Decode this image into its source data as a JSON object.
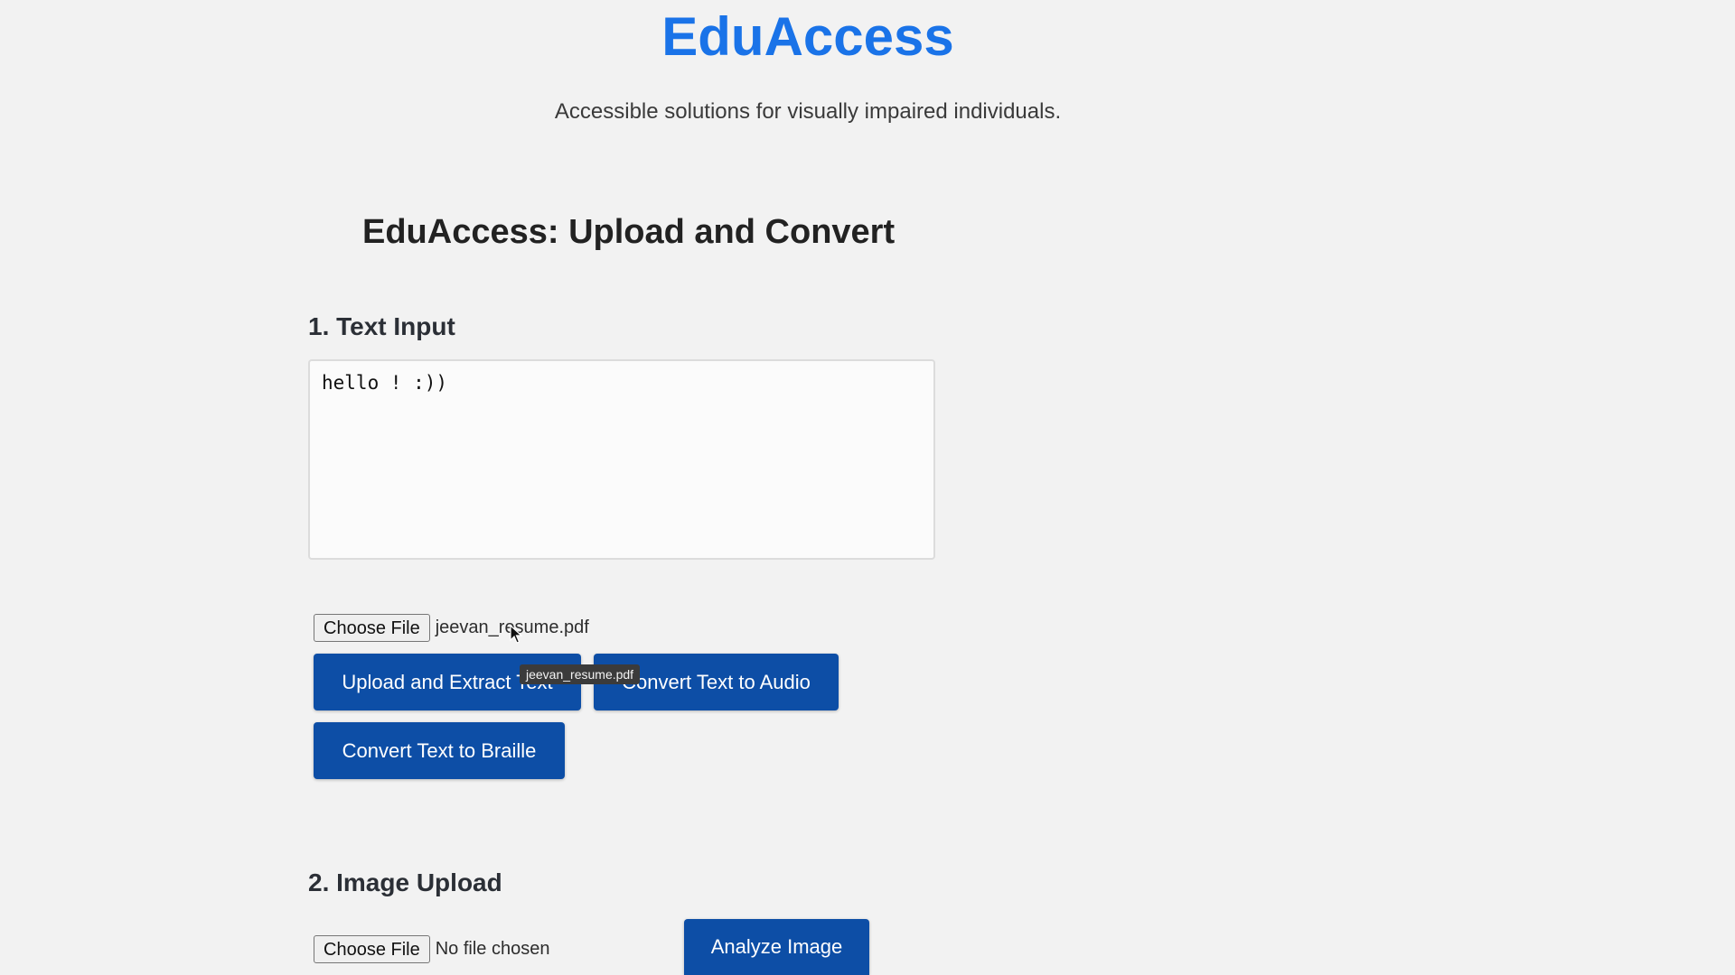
{
  "header": {
    "title": "EduAccess",
    "subtitle": "Accessible solutions for visually impaired individuals."
  },
  "main": {
    "section_title": "EduAccess: Upload and Convert",
    "text_input": {
      "heading": "1. Text Input",
      "textarea_value": "hello ! :))",
      "file_button_label": "Choose File",
      "file_name": "jeevan_resume.pdf",
      "tooltip": "jeevan_resume.pdf",
      "buttons": {
        "upload_extract": "Upload and Extract Text",
        "text_to_audio": "Convert Text to Audio",
        "text_to_braille": "Convert Text to Braille"
      }
    },
    "image_upload": {
      "heading": "2. Image Upload",
      "file_button_label": "Choose File",
      "file_status": "No file chosen",
      "analyze_button": "Analyze Image"
    }
  },
  "colors": {
    "title": "#1a73e8",
    "primary_button": "#0d4ea6",
    "background": "#f2f2f2"
  },
  "icons": {
    "cursor": "arrow-cursor-icon"
  }
}
